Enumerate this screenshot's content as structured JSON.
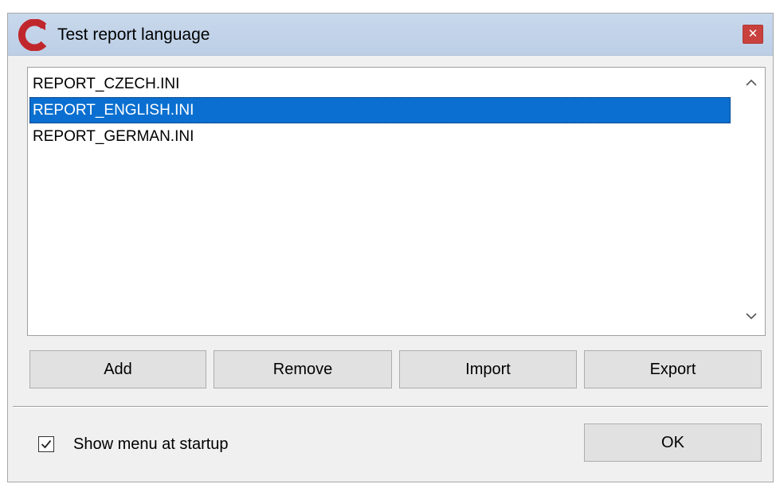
{
  "window": {
    "title": "Test report language"
  },
  "list": {
    "items": [
      {
        "label": "REPORT_CZECH.INI",
        "selected": false
      },
      {
        "label": "REPORT_ENGLISH.INI",
        "selected": true
      },
      {
        "label": "REPORT_GERMAN.INI",
        "selected": false
      }
    ]
  },
  "buttons": {
    "add": "Add",
    "remove": "Remove",
    "import": "Import",
    "export": "Export",
    "ok": "OK"
  },
  "footer": {
    "show_menu_label": "Show menu at startup",
    "show_menu_checked": true
  },
  "colors": {
    "selection": "#0a6fd0",
    "titlebar": "#bccfe6",
    "close_button": "#c9413c",
    "app_icon": "#c0272d"
  },
  "icons": {
    "app": "app-logo-icon",
    "close": "close-icon",
    "scroll_up": "chevron-up-icon",
    "scroll_down": "chevron-down-icon",
    "check": "checkmark-icon"
  }
}
